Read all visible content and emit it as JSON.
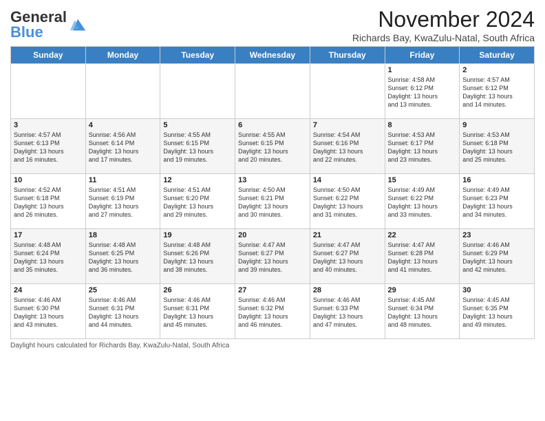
{
  "header": {
    "logo_general": "General",
    "logo_blue": "Blue",
    "month_title": "November 2024",
    "subtitle": "Richards Bay, KwaZulu-Natal, South Africa"
  },
  "days_of_week": [
    "Sunday",
    "Monday",
    "Tuesday",
    "Wednesday",
    "Thursday",
    "Friday",
    "Saturday"
  ],
  "weeks": [
    {
      "row_class": "row-1",
      "days": [
        {
          "num": "",
          "info": ""
        },
        {
          "num": "",
          "info": ""
        },
        {
          "num": "",
          "info": ""
        },
        {
          "num": "",
          "info": ""
        },
        {
          "num": "",
          "info": ""
        },
        {
          "num": "1",
          "info": "Sunrise: 4:58 AM\nSunset: 6:12 PM\nDaylight: 13 hours\nand 13 minutes."
        },
        {
          "num": "2",
          "info": "Sunrise: 4:57 AM\nSunset: 6:12 PM\nDaylight: 13 hours\nand 14 minutes."
        }
      ]
    },
    {
      "row_class": "row-2",
      "days": [
        {
          "num": "3",
          "info": "Sunrise: 4:57 AM\nSunset: 6:13 PM\nDaylight: 13 hours\nand 16 minutes."
        },
        {
          "num": "4",
          "info": "Sunrise: 4:56 AM\nSunset: 6:14 PM\nDaylight: 13 hours\nand 17 minutes."
        },
        {
          "num": "5",
          "info": "Sunrise: 4:55 AM\nSunset: 6:15 PM\nDaylight: 13 hours\nand 19 minutes."
        },
        {
          "num": "6",
          "info": "Sunrise: 4:55 AM\nSunset: 6:15 PM\nDaylight: 13 hours\nand 20 minutes."
        },
        {
          "num": "7",
          "info": "Sunrise: 4:54 AM\nSunset: 6:16 PM\nDaylight: 13 hours\nand 22 minutes."
        },
        {
          "num": "8",
          "info": "Sunrise: 4:53 AM\nSunset: 6:17 PM\nDaylight: 13 hours\nand 23 minutes."
        },
        {
          "num": "9",
          "info": "Sunrise: 4:53 AM\nSunset: 6:18 PM\nDaylight: 13 hours\nand 25 minutes."
        }
      ]
    },
    {
      "row_class": "row-3",
      "days": [
        {
          "num": "10",
          "info": "Sunrise: 4:52 AM\nSunset: 6:18 PM\nDaylight: 13 hours\nand 26 minutes."
        },
        {
          "num": "11",
          "info": "Sunrise: 4:51 AM\nSunset: 6:19 PM\nDaylight: 13 hours\nand 27 minutes."
        },
        {
          "num": "12",
          "info": "Sunrise: 4:51 AM\nSunset: 6:20 PM\nDaylight: 13 hours\nand 29 minutes."
        },
        {
          "num": "13",
          "info": "Sunrise: 4:50 AM\nSunset: 6:21 PM\nDaylight: 13 hours\nand 30 minutes."
        },
        {
          "num": "14",
          "info": "Sunrise: 4:50 AM\nSunset: 6:22 PM\nDaylight: 13 hours\nand 31 minutes."
        },
        {
          "num": "15",
          "info": "Sunrise: 4:49 AM\nSunset: 6:22 PM\nDaylight: 13 hours\nand 33 minutes."
        },
        {
          "num": "16",
          "info": "Sunrise: 4:49 AM\nSunset: 6:23 PM\nDaylight: 13 hours\nand 34 minutes."
        }
      ]
    },
    {
      "row_class": "row-4",
      "days": [
        {
          "num": "17",
          "info": "Sunrise: 4:48 AM\nSunset: 6:24 PM\nDaylight: 13 hours\nand 35 minutes."
        },
        {
          "num": "18",
          "info": "Sunrise: 4:48 AM\nSunset: 6:25 PM\nDaylight: 13 hours\nand 36 minutes."
        },
        {
          "num": "19",
          "info": "Sunrise: 4:48 AM\nSunset: 6:26 PM\nDaylight: 13 hours\nand 38 minutes."
        },
        {
          "num": "20",
          "info": "Sunrise: 4:47 AM\nSunset: 6:27 PM\nDaylight: 13 hours\nand 39 minutes."
        },
        {
          "num": "21",
          "info": "Sunrise: 4:47 AM\nSunset: 6:27 PM\nDaylight: 13 hours\nand 40 minutes."
        },
        {
          "num": "22",
          "info": "Sunrise: 4:47 AM\nSunset: 6:28 PM\nDaylight: 13 hours\nand 41 minutes."
        },
        {
          "num": "23",
          "info": "Sunrise: 4:46 AM\nSunset: 6:29 PM\nDaylight: 13 hours\nand 42 minutes."
        }
      ]
    },
    {
      "row_class": "row-5",
      "days": [
        {
          "num": "24",
          "info": "Sunrise: 4:46 AM\nSunset: 6:30 PM\nDaylight: 13 hours\nand 43 minutes."
        },
        {
          "num": "25",
          "info": "Sunrise: 4:46 AM\nSunset: 6:31 PM\nDaylight: 13 hours\nand 44 minutes."
        },
        {
          "num": "26",
          "info": "Sunrise: 4:46 AM\nSunset: 6:31 PM\nDaylight: 13 hours\nand 45 minutes."
        },
        {
          "num": "27",
          "info": "Sunrise: 4:46 AM\nSunset: 6:32 PM\nDaylight: 13 hours\nand 46 minutes."
        },
        {
          "num": "28",
          "info": "Sunrise: 4:46 AM\nSunset: 6:33 PM\nDaylight: 13 hours\nand 47 minutes."
        },
        {
          "num": "29",
          "info": "Sunrise: 4:45 AM\nSunset: 6:34 PM\nDaylight: 13 hours\nand 48 minutes."
        },
        {
          "num": "30",
          "info": "Sunrise: 4:45 AM\nSunset: 6:35 PM\nDaylight: 13 hours\nand 49 minutes."
        }
      ]
    }
  ],
  "footer": {
    "note": "Daylight hours calculated for Richards Bay, KwaZulu-Natal, South Africa"
  }
}
